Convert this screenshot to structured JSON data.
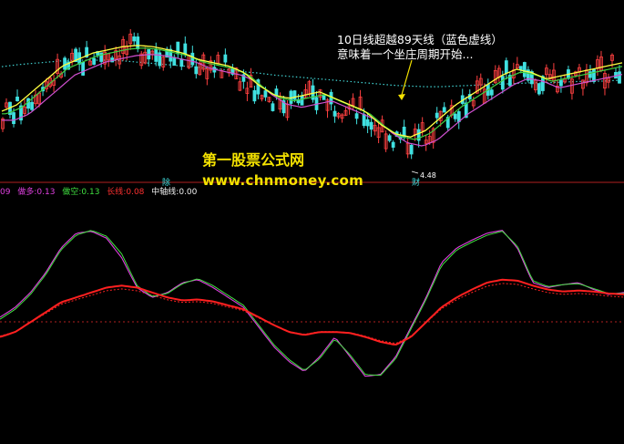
{
  "annotation": {
    "line1": "10日线超越89天线（蓝色虚线）",
    "line2": "意味着一个坐庄周期开始..."
  },
  "watermark": {
    "title": "第一股票公式网",
    "url": "www.chnmoney.com"
  },
  "price_marker": "4.48",
  "candle_tags": {
    "rest_mark": "除",
    "fin_mark": "财"
  },
  "legend": [
    {
      "label": "做多",
      "value": "0.13",
      "color": "#e040e0"
    },
    {
      "label": "做空",
      "value": "0.13",
      "color": "#40e040"
    },
    {
      "label": "长线",
      "value": "0.08",
      "color": "#ff3030"
    },
    {
      "label": "中轴线",
      "value": "0.00",
      "color": "#f0f0f0"
    }
  ],
  "legend_partial_prefix": "09",
  "colors": {
    "background": "#000000",
    "up_candle": "#ff4040",
    "down_candle": "#40e0e0",
    "ma_yellow": "#ffff40",
    "ma_purple": "#d050d0",
    "ma_green": "#40d040",
    "ma89_dotted": "#40d0d0",
    "long_line": "#ff2020",
    "bull_line": "#e040e0",
    "bear_line": "#40e040",
    "axis_line": "#b02020"
  },
  "chart_data": {
    "type": "line",
    "panels": [
      {
        "name": "price",
        "series": [
          {
            "name": "10日线",
            "values": [
              5.2,
              5.3,
              5.5,
              5.7,
              5.9,
              6.0,
              6.1,
              6.15,
              6.2,
              6.22,
              6.2,
              6.15,
              6.1,
              6.0,
              5.95,
              5.9,
              5.8,
              5.6,
              5.45,
              5.4,
              5.45,
              5.5,
              5.4,
              5.3,
              5.2,
              5.0,
              4.85,
              4.8,
              4.9,
              5.1,
              5.3,
              5.45,
              5.6,
              5.75,
              5.85,
              5.8,
              5.7,
              5.75,
              5.8,
              5.85,
              5.9,
              5.95
            ]
          },
          {
            "name": "89天线",
            "values": [
              5.95,
              5.98,
              6.0,
              6.02,
              6.04,
              6.05,
              6.05,
              6.05,
              6.04,
              6.02,
              6.0,
              5.98,
              5.96,
              5.94,
              5.92,
              5.9,
              5.87,
              5.85,
              5.82,
              5.8,
              5.78,
              5.76,
              5.74,
              5.72,
              5.7,
              5.68,
              5.66,
              5.65,
              5.64,
              5.64,
              5.65,
              5.66,
              5.67,
              5.68,
              5.69,
              5.7,
              5.7,
              5.71,
              5.72,
              5.72,
              5.73,
              5.74
            ]
          }
        ]
      },
      {
        "name": "indicator",
        "series": [
          {
            "name": "做多",
            "values": [
              0.1,
              0.2,
              0.35,
              0.55,
              0.8,
              0.95,
              0.97,
              0.9,
              0.7,
              0.4,
              0.3,
              0.35,
              0.45,
              0.48,
              0.4,
              0.3,
              0.2,
              0.0,
              -0.2,
              -0.35,
              -0.45,
              -0.3,
              -0.1,
              -0.3,
              -0.5,
              -0.48,
              -0.3,
              0.0,
              0.3,
              0.65,
              0.8,
              0.88,
              0.95,
              0.98,
              0.8,
              0.45,
              0.4,
              0.43,
              0.45,
              0.38,
              0.33,
              0.35
            ]
          },
          {
            "name": "做空",
            "values": [
              0.08,
              0.18,
              0.33,
              0.53,
              0.78,
              0.93,
              0.98,
              0.92,
              0.74,
              0.42,
              0.31,
              0.34,
              0.44,
              0.49,
              0.42,
              0.32,
              0.22,
              0.02,
              -0.18,
              -0.33,
              -0.44,
              -0.32,
              -0.12,
              -0.28,
              -0.48,
              -0.49,
              -0.32,
              -0.02,
              0.28,
              0.62,
              0.78,
              0.86,
              0.93,
              0.97,
              0.82,
              0.47,
              0.41,
              0.43,
              0.44,
              0.39,
              0.34,
              0.34
            ]
          },
          {
            "name": "长线",
            "values": [
              -0.1,
              -0.05,
              0.05,
              0.15,
              0.25,
              0.3,
              0.35,
              0.4,
              0.42,
              0.4,
              0.35,
              0.3,
              0.27,
              0.28,
              0.26,
              0.22,
              0.18,
              0.1,
              0.02,
              -0.05,
              -0.08,
              -0.05,
              -0.05,
              -0.06,
              -0.1,
              -0.15,
              -0.18,
              -0.1,
              0.05,
              0.2,
              0.3,
              0.38,
              0.45,
              0.48,
              0.47,
              0.42,
              0.38,
              0.36,
              0.37,
              0.36,
              0.34,
              0.33
            ]
          }
        ]
      }
    ]
  }
}
